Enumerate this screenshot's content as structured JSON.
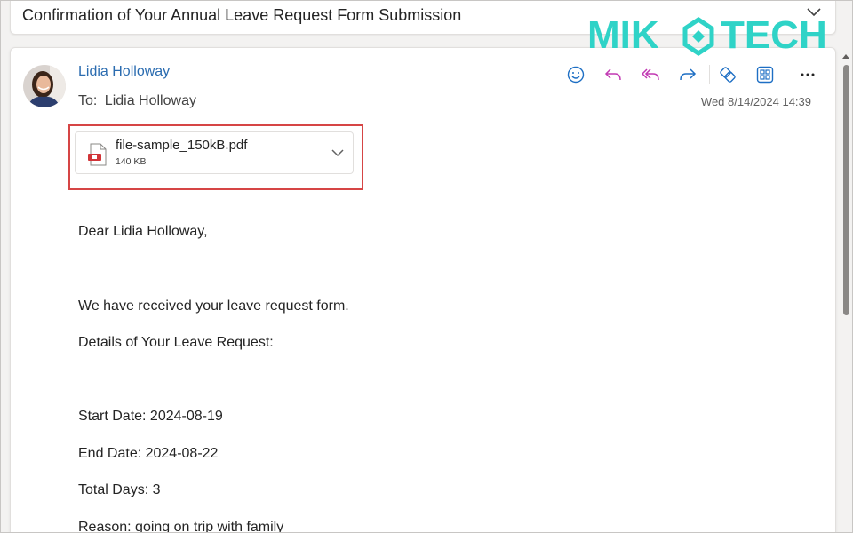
{
  "subject": "Confirmation of Your Annual Leave Request Form Submission",
  "logo": {
    "text_left": "MIK",
    "text_right": "TECH",
    "color": "#2fd3c7"
  },
  "sender": {
    "name": "Lidia Holloway"
  },
  "recipient": {
    "label": "To:",
    "name": "Lidia Holloway"
  },
  "date": "Wed 8/14/2024 14:39",
  "actions": [
    {
      "name": "react-icon"
    },
    {
      "name": "reply-icon"
    },
    {
      "name": "reply-all-icon"
    },
    {
      "name": "forward-icon"
    },
    {
      "name": "loop-icon"
    },
    {
      "name": "apps-icon"
    },
    {
      "name": "more-icon"
    }
  ],
  "attachment": {
    "filename": "file-sample_150kB.pdf",
    "size": "140 KB",
    "highlight_color": "#d64545"
  },
  "body": {
    "greeting": "Dear Lidia Holloway,",
    "line1": "We have received your leave request form.",
    "line2": "Details of Your Leave Request:",
    "start": "Start Date: 2024-08-19",
    "end": "End Date: 2024-08-22",
    "total": "Total Days: 3",
    "reason": "Reason: going on trip with family"
  },
  "colors": {
    "accent": "#2b6cb0",
    "icon": "#1e6fc4",
    "forward": "#c239b3"
  }
}
